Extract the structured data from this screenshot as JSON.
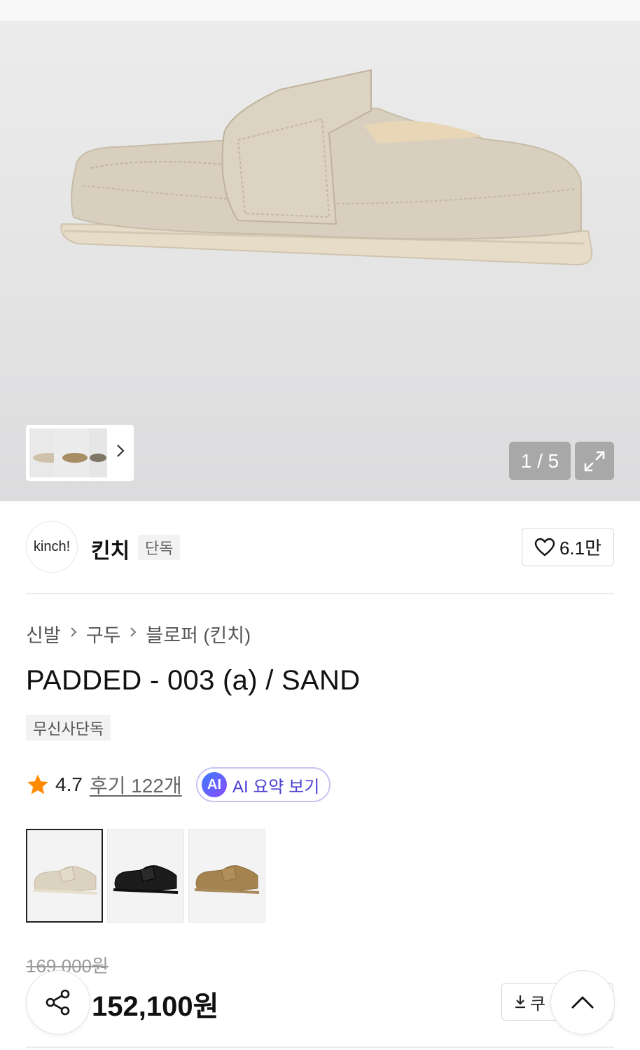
{
  "gallery": {
    "counter": "1 / 5",
    "image_icon": "shoe-product-image",
    "expand_icon": "expand-icon",
    "next_icon": "chevron-right-icon"
  },
  "brand": {
    "logo_text": "kinch!",
    "name": "킨치",
    "tag": "단독",
    "likes": "6.1만"
  },
  "breadcrumb": [
    "신발",
    "구두",
    "블로퍼 (킨치)"
  ],
  "product": {
    "title": "PADDED - 003 (a) / SAND",
    "exclusive_badge": "무신사단독",
    "rating": "4.7",
    "reviews_label": "후기 122개",
    "ai_badge": "AI",
    "ai_summary_label": "AI 요약 보기",
    "variants": [
      "sand",
      "black",
      "brown"
    ],
    "original_price": "169,000원",
    "sale_price": "152,100원"
  },
  "actions": {
    "coupon_label": "쿠",
    "share_icon": "share-icon",
    "top_icon": "chevron-up-icon"
  },
  "colors": {
    "accent_purple": "#4b3fd1",
    "star": "#ff8a00",
    "sand": "#d7cdb9"
  }
}
